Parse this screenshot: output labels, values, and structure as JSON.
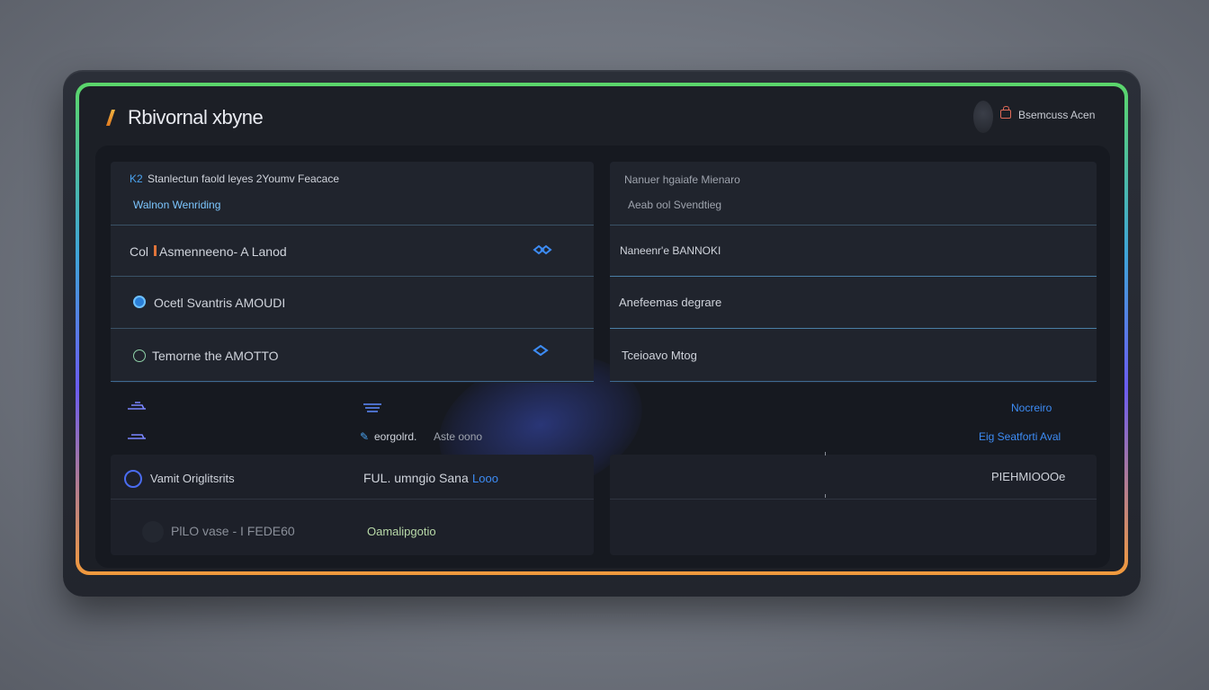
{
  "app": {
    "title": "Rbivornal xbyne",
    "account_label": "Bsemcuss Acen"
  },
  "table_top": {
    "left_header": {
      "line1": "Stanlectun faold leyes 2Youmv Feacace",
      "line1_prefix": "K2",
      "line2": "Walnon Wenriding"
    },
    "right_header": {
      "line1": "Nanuer hgaiafe Mienaro",
      "line2": "Aeab ool Svendtieg"
    },
    "left_rows": [
      {
        "prefix": "Col",
        "label": "Asmenneeno- A Lanod",
        "icon": "double-chevron-icon"
      },
      {
        "prefix": "",
        "label": "Ocetl Svantris AMOUDI",
        "icon": "circle-arrow-icon"
      },
      {
        "prefix": "",
        "label": "Temorne the AMOTTO",
        "icon": "circle-refresh-icon"
      }
    ],
    "right_rows": [
      {
        "label": "Naneenr'e BANNOKI"
      },
      {
        "label": "Anefeemas degrare"
      },
      {
        "label": "Tceioavo Mtog"
      }
    ]
  },
  "table_bottom": {
    "meta_rows": [
      {
        "left_icon": "ship-icon",
        "mid_icon": "menu-lines-icon",
        "mid_label": "",
        "right_label": "Nocreiro"
      },
      {
        "left_icon": "ship-icon",
        "mid_icon": "edit-icon",
        "mid_label": "eorgolrd.",
        "mid_label2": "Aste oono",
        "right_label": "Eig Seatforti Aval"
      }
    ],
    "rows": [
      {
        "icon": "shield-icon",
        "label": "Vamit Origlitsrits",
        "mid_label": "FUL. umngio Sana",
        "mid_value": "Looo",
        "right_label": "PIEHMIOOOe"
      },
      {
        "icon": "",
        "label": "PlLO vase - I FEDE60",
        "mid_label": "Oamalipgotio",
        "mid_value": "",
        "right_label": ""
      }
    ]
  },
  "colors": {
    "accent_blue": "#4aa3f0",
    "accent_orange": "#f29a3c",
    "accent_green": "#5bd66a",
    "danger": "#e06a58"
  }
}
